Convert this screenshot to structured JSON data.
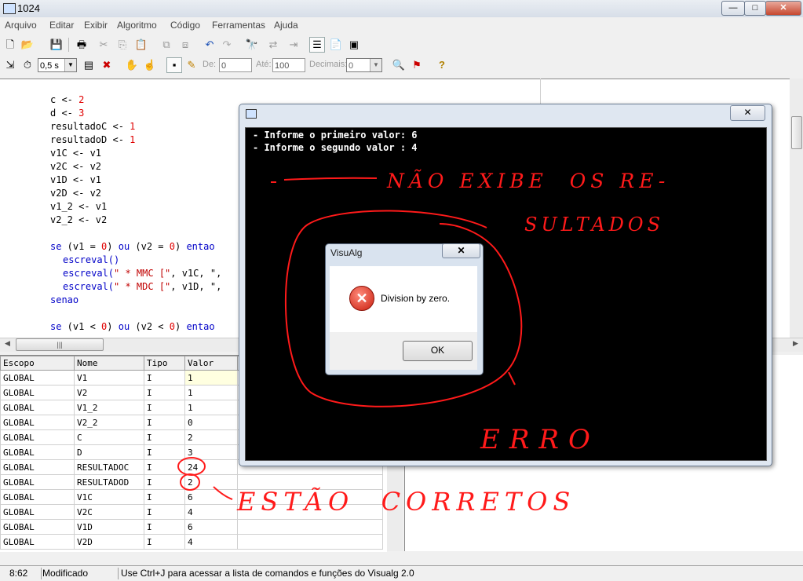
{
  "window": {
    "title": "1024",
    "minimize": "—",
    "maximize": "□",
    "close": "✕"
  },
  "menu": [
    "Arquivo",
    "Editar",
    "Exibir",
    "Algoritmo",
    "Código",
    "Ferramentas",
    "Ajuda"
  ],
  "toolbar2": {
    "speed": "0,5 s",
    "de_label": "De:",
    "de_value": "0",
    "ate_label": "Até:",
    "ate_value": "100",
    "decimais_label": "Decimais:",
    "decimais_value": "0"
  },
  "code_lines": [
    {
      "a": "c <- ",
      "b": "2"
    },
    {
      "a": "d <- ",
      "b": "3"
    },
    {
      "a": "resultadoC <- ",
      "b": "1"
    },
    {
      "a": "resultadoD <- ",
      "b": "1"
    },
    {
      "a": "v1C <- v1",
      "b": ""
    },
    {
      "a": "v2C <- v2",
      "b": ""
    },
    {
      "a": "v1D <- v1",
      "b": ""
    },
    {
      "a": "v2D <- v2",
      "b": ""
    },
    {
      "a": "v1_2 <- v1",
      "b": ""
    },
    {
      "a": "v2_2 <- v2",
      "b": ""
    }
  ],
  "code_block": {
    "se1": "se",
    "se1_rest": " (v1 = ",
    "zero": "0",
    "ou": "ou",
    "v2eq": " (v2 = ",
    "entao": "entao",
    "escreval_empty": "escreval()",
    "escreval1": "escreval(",
    "mmc_str": "\" * MMC [\"",
    "mmc_rest": ", v1C, \",",
    "escreval2": "escreval(",
    "mdc_str": "\" * MDC [\"",
    "mdc_rest": ", v1D, \",",
    "senao": "senao",
    "se2": "se",
    "se2_rest": " (v1 < ",
    "ou2": "ou",
    "v2lt": " (v2 < ",
    "entao2": "entao"
  },
  "vars": {
    "headers": [
      "Escopo",
      "Nome",
      "Tipo",
      "Valor"
    ],
    "rows": [
      [
        "GLOBAL",
        "V1",
        "I",
        "1"
      ],
      [
        "GLOBAL",
        "V2",
        "I",
        "1"
      ],
      [
        "GLOBAL",
        "V1_2",
        "I",
        "1"
      ],
      [
        "GLOBAL",
        "V2_2",
        "I",
        "0"
      ],
      [
        "GLOBAL",
        "C",
        "I",
        "2"
      ],
      [
        "GLOBAL",
        "D",
        "I",
        "3"
      ],
      [
        "GLOBAL",
        "RESULTADOC",
        "I",
        "24"
      ],
      [
        "GLOBAL",
        "RESULTADOD",
        "I",
        "2"
      ],
      [
        "GLOBAL",
        "V1C",
        "I",
        "6"
      ],
      [
        "GLOBAL",
        "V2C",
        "I",
        "4"
      ],
      [
        "GLOBAL",
        "V1D",
        "I",
        "6"
      ],
      [
        "GLOBAL",
        "V2D",
        "I",
        "4"
      ]
    ]
  },
  "console": {
    "line1": "- Informe o primeiro valor: 6",
    "line2": "- Informe o segundo valor : 4"
  },
  "dialog": {
    "title": "VisuAlg",
    "message": "Division by zero.",
    "ok": "OK",
    "close": "✕"
  },
  "annotations": {
    "a1": "NÃO EXIBE  OS RE-",
    "a2": "SULTADOS",
    "a3": "ERRO",
    "a4": "ESTÃO  CORRETOS"
  },
  "status": {
    "position": "8:62",
    "state": "Modificado",
    "hint": "Use Ctrl+J para acessar a lista de comandos e funções do Visualg 2.0"
  }
}
